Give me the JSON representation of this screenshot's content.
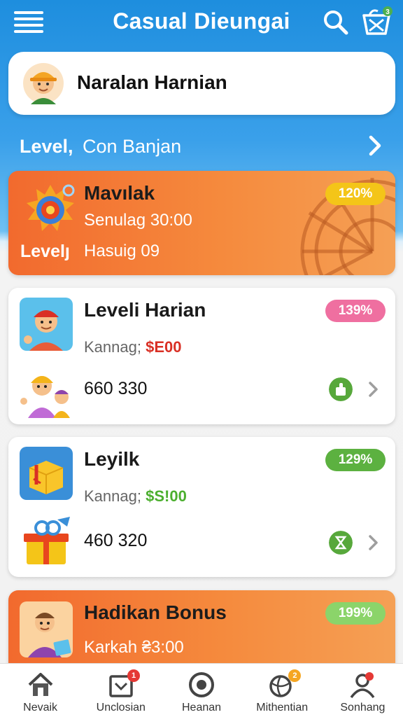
{
  "app": {
    "title": "Casual Dieungai"
  },
  "header": {
    "menu_icon": "hamburger-menu-icon",
    "search_icon": "search-icon",
    "cart_icon": "shopping-basket-icon",
    "cart_badge": "3"
  },
  "profile": {
    "name": "Naralan Harnian",
    "avatar_icon": "worker-avatar-icon"
  },
  "level_row": {
    "label": "Level,",
    "value": "Con Banjan",
    "chevron_icon": "chevron-right-icon"
  },
  "featured": {
    "title": "Mavılak",
    "subtitle": "Senulag 30:00",
    "level_label": "Levelȷ",
    "level_value": "Hasuig 09",
    "percent": "120%",
    "icon": "target-icon",
    "decor_icon": "ferris-wheel-icon"
  },
  "cards": [
    {
      "title": "Leveli Harian",
      "label": "Kannag;",
      "amount": "$E00",
      "amount_color": "#d93025",
      "numbers": "660  330",
      "percent": "139%",
      "percent_color": "#ef6fa0",
      "badge_color": "#57a83b",
      "icon": "kid-avatar-icon",
      "sub_icon": "worker-family-icon",
      "badge_icon": "thumbs-up-icon"
    },
    {
      "title": "Leyilk",
      "label": "Kannag;",
      "amount": "$S!00",
      "amount_color": "#4caf2f",
      "numbers": "460  320",
      "percent": "129%",
      "percent_color": "#5cb140",
      "badge_color": "#57a83b",
      "icon": "gift-box-icon",
      "sub_icon": "gift-ribbon-icon",
      "badge_icon": "hourglass-icon"
    }
  ],
  "bonus": {
    "title": "Hadikan Bonus",
    "subtitle": "Karkah ₴3:00",
    "percent": "199%",
    "icon": "shopper-avatar-icon"
  },
  "nav": [
    {
      "label": "Nevaik",
      "icon": "home-icon",
      "badge": ""
    },
    {
      "label": "Unclosian",
      "icon": "inbox-icon",
      "badge": "1"
    },
    {
      "label": "Heanan",
      "icon": "record-icon",
      "badge": ""
    },
    {
      "label": "Mithentian",
      "icon": "globe-icon",
      "badge": "2"
    },
    {
      "label": "Sonhang",
      "icon": "profile-icon",
      "badge": ""
    }
  ],
  "colors": {
    "header_blue": "#1e8ede",
    "orange_card": "#f26a2e",
    "featured_pill": "#f4c518",
    "bonus_pill": "#8bd46a"
  }
}
